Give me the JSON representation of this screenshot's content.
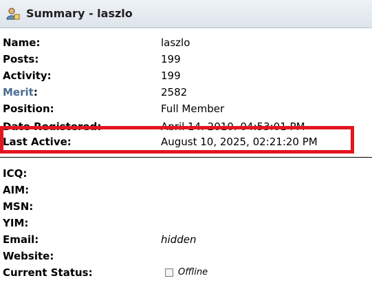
{
  "header": {
    "title": "Summary - laszlo",
    "icon": "user-profile-icon"
  },
  "profile": {
    "name_label": "Name:",
    "name_value": "laszlo",
    "posts_label": "Posts:",
    "posts_value": "199",
    "activity_label": "Activity:",
    "activity_value": "199",
    "merit_label": "Merit",
    "merit_colon": ":",
    "merit_value": "2582",
    "position_label": "Position:",
    "position_value": "Full Member",
    "registered_label": "Date Registered:",
    "registered_value": "April 14, 2010, 04:53:01 PM",
    "last_active_label": "Last Active:",
    "last_active_value": "August 10, 2025, 02:21:20 PM"
  },
  "contact": {
    "icq_label": "ICQ:",
    "aim_label": "AIM:",
    "msn_label": "MSN:",
    "yim_label": "YIM:",
    "email_label": "Email:",
    "email_value": "hidden",
    "website_label": "Website:",
    "status_label": "Current Status:",
    "status_value": "Offline"
  },
  "colors": {
    "highlight_border": "#e3161f",
    "merit_link": "#476c8e"
  }
}
